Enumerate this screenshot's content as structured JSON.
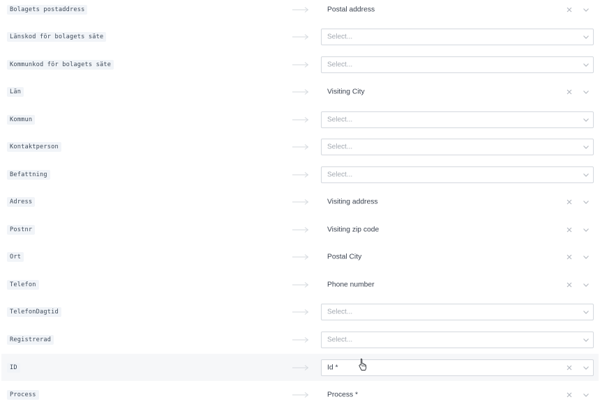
{
  "mapping_rows": [
    {
      "source": "Bolagets postaddress",
      "mode": "value",
      "value": "Postal address",
      "placeholder": ""
    },
    {
      "source": "Länskod för bolagets säte",
      "mode": "select",
      "value": "",
      "placeholder": "Select..."
    },
    {
      "source": "Kommunkod för bolagets säte",
      "mode": "select",
      "value": "",
      "placeholder": "Select..."
    },
    {
      "source": "Län",
      "mode": "value",
      "value": "Visiting City",
      "placeholder": ""
    },
    {
      "source": "Kommun",
      "mode": "select",
      "value": "",
      "placeholder": "Select..."
    },
    {
      "source": "Kontaktperson",
      "mode": "select",
      "value": "",
      "placeholder": "Select..."
    },
    {
      "source": "Befattning",
      "mode": "select",
      "value": "",
      "placeholder": "Select..."
    },
    {
      "source": "Adress",
      "mode": "value",
      "value": "Visiting address",
      "placeholder": ""
    },
    {
      "source": "Postnr",
      "mode": "value",
      "value": "Visiting zip code",
      "placeholder": ""
    },
    {
      "source": "Ort",
      "mode": "value",
      "value": "Postal City",
      "placeholder": ""
    },
    {
      "source": "Telefon",
      "mode": "value",
      "value": "Phone number",
      "placeholder": ""
    },
    {
      "source": "TelefonDagtid",
      "mode": "select",
      "value": "",
      "placeholder": "Select..."
    },
    {
      "source": "Registrerad",
      "mode": "select",
      "value": "",
      "placeholder": "Select..."
    },
    {
      "source": "ID",
      "mode": "boxed-value",
      "value": "Id *",
      "placeholder": "",
      "hovered": true
    },
    {
      "source": "Process",
      "mode": "value",
      "value": "Process *",
      "placeholder": ""
    }
  ],
  "icons": {
    "arrow": "arrow-right-icon",
    "clear": "close-icon",
    "dropdown": "chevron-down-icon",
    "cursor": "hand-pointer-cursor-icon"
  },
  "colors": {
    "source_tag_bg": "#f1f4f8",
    "source_tag_text": "#3e4a59",
    "value_text": "#3b4350",
    "placeholder_text": "#a3a9b1",
    "input_border": "#d4d8de",
    "icon_gray": "#b6bbc2",
    "arrow_gray": "#d5d9de",
    "hover_row_bg": "#f6f7f9"
  }
}
